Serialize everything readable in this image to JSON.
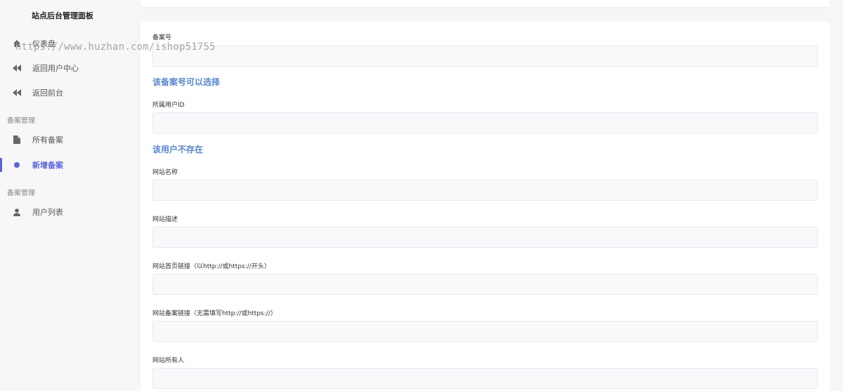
{
  "sidebar": {
    "brand": "站点后台管理面板",
    "items": [
      {
        "label": "仪表盘",
        "icon": "home-icon"
      },
      {
        "label": "返回用户中心",
        "icon": "backward-icon"
      },
      {
        "label": "返回前台",
        "icon": "backward-icon"
      }
    ],
    "sections": [
      {
        "title": "备案管理",
        "items": [
          {
            "label": "所有备案",
            "icon": "file-icon"
          },
          {
            "label": "新增备案",
            "icon": "dot-icon",
            "active": true
          }
        ]
      },
      {
        "title": "备案管理",
        "items": [
          {
            "label": "用户列表",
            "icon": "user-icon"
          }
        ]
      }
    ]
  },
  "watermark": "https://www.huzhan.com/ishop51755",
  "form": {
    "fields": [
      {
        "label": "备案号",
        "value": ""
      },
      {
        "label": "所属用户ID",
        "value": ""
      },
      {
        "label": "网站名称",
        "value": ""
      },
      {
        "label": "网站描述",
        "value": ""
      },
      {
        "label": "网站首页链接（以http://或https://开头）",
        "value": ""
      },
      {
        "label": "网站备案链接（无需填写http://或https://）",
        "value": ""
      },
      {
        "label": "网站所有人",
        "value": ""
      }
    ],
    "hints": {
      "record_available": "该备案号可以选择",
      "user_not_exist": "该用户不存在"
    }
  },
  "colors": {
    "accent": "#5865d8",
    "hint": "#5a86cc",
    "sidebar_bg": "#f7f7f9",
    "page_bg": "#f5f6f8"
  }
}
